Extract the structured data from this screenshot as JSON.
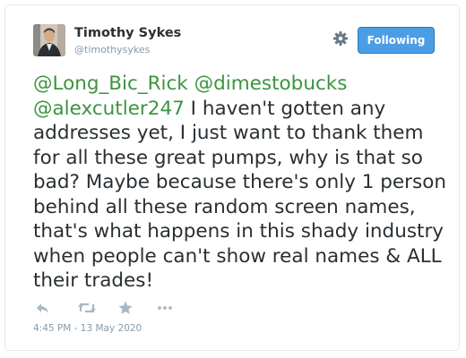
{
  "user": {
    "name": "Timothy Sykes",
    "handle": "@timothysykes",
    "follow_label": "Following",
    "avatar_icon": "profile-photo"
  },
  "tweet": {
    "mentions": [
      "@Long_Bic_Rick",
      "@dimestobucks",
      "@alexcutler247"
    ],
    "body": "I haven't gotten any addresses yet, I just want to thank them for all these great pumps, why is that so bad? Maybe because there's only 1 person behind all these random screen names, that's what happens in this shady industry when people can't show real names & ALL their trades!",
    "timestamp": "4:45 PM - 13 May 2020"
  },
  "actions": {
    "icons": [
      "reply-icon",
      "retweet-icon",
      "like-icon",
      "more-icon"
    ]
  },
  "colors": {
    "mention": "#3c9440",
    "follow_button": "#4c9de6",
    "text": "#292f33",
    "muted": "#8899a6"
  }
}
